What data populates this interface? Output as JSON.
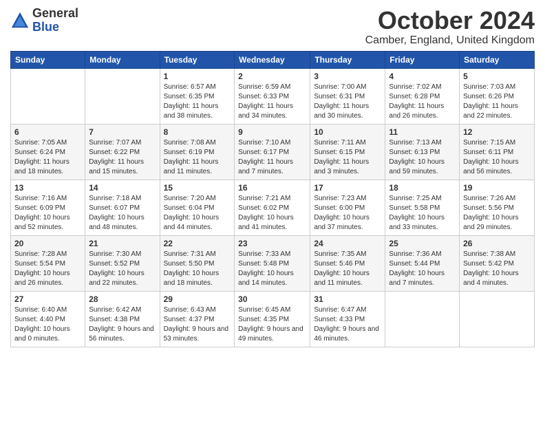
{
  "header": {
    "logo_general": "General",
    "logo_blue": "Blue",
    "month_title": "October 2024",
    "location": "Camber, England, United Kingdom"
  },
  "days_of_week": [
    "Sunday",
    "Monday",
    "Tuesday",
    "Wednesday",
    "Thursday",
    "Friday",
    "Saturday"
  ],
  "weeks": [
    [
      {
        "day": "",
        "info": ""
      },
      {
        "day": "",
        "info": ""
      },
      {
        "day": "1",
        "info": "Sunrise: 6:57 AM\nSunset: 6:35 PM\nDaylight: 11 hours and 38 minutes."
      },
      {
        "day": "2",
        "info": "Sunrise: 6:59 AM\nSunset: 6:33 PM\nDaylight: 11 hours and 34 minutes."
      },
      {
        "day": "3",
        "info": "Sunrise: 7:00 AM\nSunset: 6:31 PM\nDaylight: 11 hours and 30 minutes."
      },
      {
        "day": "4",
        "info": "Sunrise: 7:02 AM\nSunset: 6:28 PM\nDaylight: 11 hours and 26 minutes."
      },
      {
        "day": "5",
        "info": "Sunrise: 7:03 AM\nSunset: 6:26 PM\nDaylight: 11 hours and 22 minutes."
      }
    ],
    [
      {
        "day": "6",
        "info": "Sunrise: 7:05 AM\nSunset: 6:24 PM\nDaylight: 11 hours and 18 minutes."
      },
      {
        "day": "7",
        "info": "Sunrise: 7:07 AM\nSunset: 6:22 PM\nDaylight: 11 hours and 15 minutes."
      },
      {
        "day": "8",
        "info": "Sunrise: 7:08 AM\nSunset: 6:19 PM\nDaylight: 11 hours and 11 minutes."
      },
      {
        "day": "9",
        "info": "Sunrise: 7:10 AM\nSunset: 6:17 PM\nDaylight: 11 hours and 7 minutes."
      },
      {
        "day": "10",
        "info": "Sunrise: 7:11 AM\nSunset: 6:15 PM\nDaylight: 11 hours and 3 minutes."
      },
      {
        "day": "11",
        "info": "Sunrise: 7:13 AM\nSunset: 6:13 PM\nDaylight: 10 hours and 59 minutes."
      },
      {
        "day": "12",
        "info": "Sunrise: 7:15 AM\nSunset: 6:11 PM\nDaylight: 10 hours and 56 minutes."
      }
    ],
    [
      {
        "day": "13",
        "info": "Sunrise: 7:16 AM\nSunset: 6:09 PM\nDaylight: 10 hours and 52 minutes."
      },
      {
        "day": "14",
        "info": "Sunrise: 7:18 AM\nSunset: 6:07 PM\nDaylight: 10 hours and 48 minutes."
      },
      {
        "day": "15",
        "info": "Sunrise: 7:20 AM\nSunset: 6:04 PM\nDaylight: 10 hours and 44 minutes."
      },
      {
        "day": "16",
        "info": "Sunrise: 7:21 AM\nSunset: 6:02 PM\nDaylight: 10 hours and 41 minutes."
      },
      {
        "day": "17",
        "info": "Sunrise: 7:23 AM\nSunset: 6:00 PM\nDaylight: 10 hours and 37 minutes."
      },
      {
        "day": "18",
        "info": "Sunrise: 7:25 AM\nSunset: 5:58 PM\nDaylight: 10 hours and 33 minutes."
      },
      {
        "day": "19",
        "info": "Sunrise: 7:26 AM\nSunset: 5:56 PM\nDaylight: 10 hours and 29 minutes."
      }
    ],
    [
      {
        "day": "20",
        "info": "Sunrise: 7:28 AM\nSunset: 5:54 PM\nDaylight: 10 hours and 26 minutes."
      },
      {
        "day": "21",
        "info": "Sunrise: 7:30 AM\nSunset: 5:52 PM\nDaylight: 10 hours and 22 minutes."
      },
      {
        "day": "22",
        "info": "Sunrise: 7:31 AM\nSunset: 5:50 PM\nDaylight: 10 hours and 18 minutes."
      },
      {
        "day": "23",
        "info": "Sunrise: 7:33 AM\nSunset: 5:48 PM\nDaylight: 10 hours and 14 minutes."
      },
      {
        "day": "24",
        "info": "Sunrise: 7:35 AM\nSunset: 5:46 PM\nDaylight: 10 hours and 11 minutes."
      },
      {
        "day": "25",
        "info": "Sunrise: 7:36 AM\nSunset: 5:44 PM\nDaylight: 10 hours and 7 minutes."
      },
      {
        "day": "26",
        "info": "Sunrise: 7:38 AM\nSunset: 5:42 PM\nDaylight: 10 hours and 4 minutes."
      }
    ],
    [
      {
        "day": "27",
        "info": "Sunrise: 6:40 AM\nSunset: 4:40 PM\nDaylight: 10 hours and 0 minutes."
      },
      {
        "day": "28",
        "info": "Sunrise: 6:42 AM\nSunset: 4:38 PM\nDaylight: 9 hours and 56 minutes."
      },
      {
        "day": "29",
        "info": "Sunrise: 6:43 AM\nSunset: 4:37 PM\nDaylight: 9 hours and 53 minutes."
      },
      {
        "day": "30",
        "info": "Sunrise: 6:45 AM\nSunset: 4:35 PM\nDaylight: 9 hours and 49 minutes."
      },
      {
        "day": "31",
        "info": "Sunrise: 6:47 AM\nSunset: 4:33 PM\nDaylight: 9 hours and 46 minutes."
      },
      {
        "day": "",
        "info": ""
      },
      {
        "day": "",
        "info": ""
      }
    ]
  ]
}
